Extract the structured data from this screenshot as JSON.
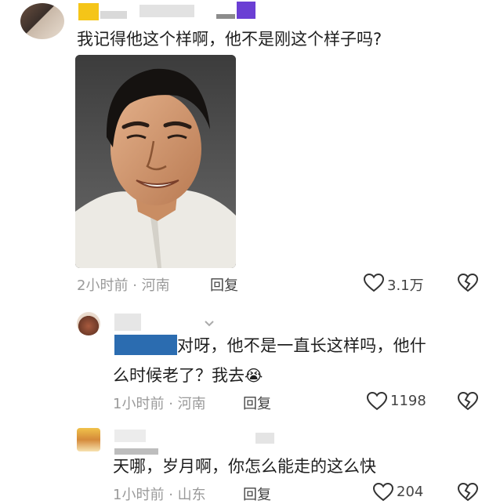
{
  "comments": [
    {
      "text": "我记得他这个样啊，他不是刚这个样子吗?",
      "time": "2小时前",
      "location": "河南",
      "reply_label": "回复",
      "likes": "3.1万"
    },
    {
      "text_line1": "对呀，他不是一直长这样吗，他什",
      "text_line2": "么时候老了？我去",
      "emoji": "😭",
      "time": "1小时前",
      "location": "河南",
      "reply_label": "回复",
      "likes": "1198"
    },
    {
      "text": "天哪，岁月啊，你怎么能走的这么快",
      "time": "1小时前",
      "location": "山东",
      "reply_label": "回复",
      "likes": "204"
    }
  ],
  "meta_separator": "·",
  "colors": {
    "meta_gray": "#9a9a9a",
    "text": "#1f1f1f",
    "photo_bg": "#4a4a4a",
    "censor_blue": "#2b6cb0",
    "censor_purple": "#6b3fd4",
    "censor_yellow": "#f5c518"
  },
  "icons": {
    "like": "heart-outline-icon",
    "dislike": "broken-heart-icon",
    "chevron": "chevron-down-icon"
  }
}
